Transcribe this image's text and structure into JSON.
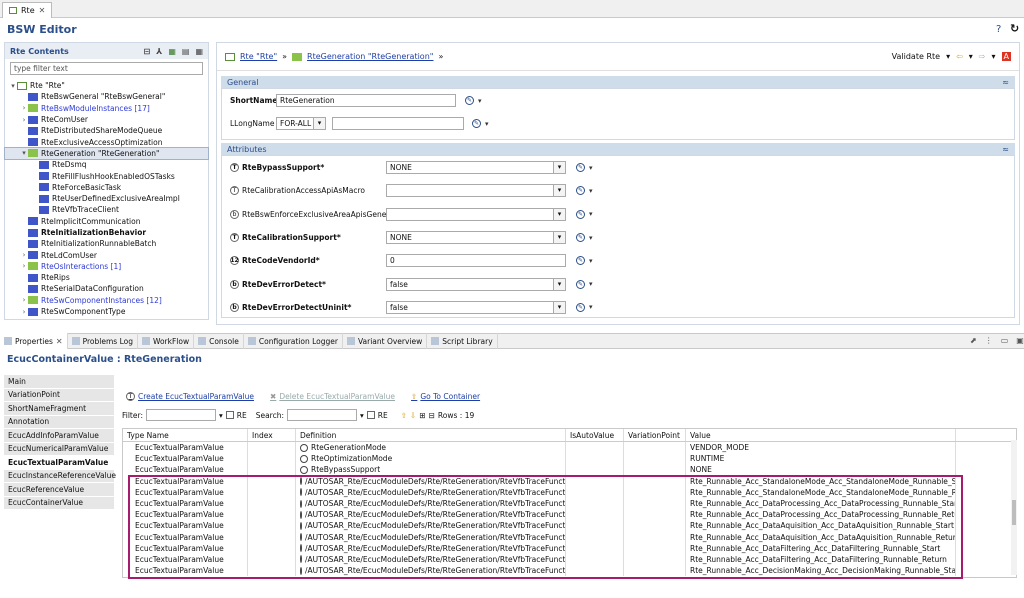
{
  "editor_tab": {
    "label": "Rte"
  },
  "editor_title": "BSW Editor",
  "left": {
    "header": "Rte Contents",
    "filter_placeholder": "type filter text",
    "tree": [
      {
        "label": "Rte \"Rte\"",
        "level": 0,
        "tw": "▾",
        "icon": "boxed"
      },
      {
        "label": "RteBswGeneral \"RteBswGeneral\"",
        "level": 1,
        "tw": "",
        "icon": "blue"
      },
      {
        "label": "RteBswModuleInstances [17]",
        "level": 1,
        "tw": "›",
        "icon": "green",
        "style": "blue-text"
      },
      {
        "label": "RteComUser",
        "level": 1,
        "tw": "›",
        "icon": "blue"
      },
      {
        "label": "RteDistributedShareModeQueue",
        "level": 1,
        "tw": "",
        "icon": "blue"
      },
      {
        "label": "RteExclusiveAccessOptimization",
        "level": 1,
        "tw": "",
        "icon": "blue"
      },
      {
        "label": "RteGeneration \"RteGeneration\"",
        "level": 1,
        "tw": "▾",
        "icon": "green",
        "selected": true
      },
      {
        "label": "RteDsmq",
        "level": 2,
        "tw": "",
        "icon": "blue"
      },
      {
        "label": "RteFillFlushHookEnabledOSTasks",
        "level": 2,
        "tw": "",
        "icon": "blue"
      },
      {
        "label": "RteForceBasicTask",
        "level": 2,
        "tw": "",
        "icon": "blue"
      },
      {
        "label": "RteUserDefinedExclusiveAreaImpl",
        "level": 2,
        "tw": "",
        "icon": "blue"
      },
      {
        "label": "RteVfbTraceClient",
        "level": 2,
        "tw": "",
        "icon": "blue"
      },
      {
        "label": "RteImplicitCommunication",
        "level": 1,
        "tw": "",
        "icon": "blue"
      },
      {
        "label": "RteInitializationBehavior",
        "level": 1,
        "tw": "",
        "icon": "blue",
        "style": "bold"
      },
      {
        "label": "RteInitializationRunnableBatch",
        "level": 1,
        "tw": "",
        "icon": "blue"
      },
      {
        "label": "RteLdComUser",
        "level": 1,
        "tw": "›",
        "icon": "blue"
      },
      {
        "label": "RteOsInteractions [1]",
        "level": 1,
        "tw": "›",
        "icon": "green",
        "style": "blue-text"
      },
      {
        "label": "RteRips",
        "level": 1,
        "tw": "",
        "icon": "blue"
      },
      {
        "label": "RteSerialDataConfiguration",
        "level": 1,
        "tw": "",
        "icon": "blue"
      },
      {
        "label": "RteSwComponentInstances [12]",
        "level": 1,
        "tw": "›",
        "icon": "green",
        "style": "blue-text"
      },
      {
        "label": "RteSwComponentType",
        "level": 1,
        "tw": "›",
        "icon": "blue"
      }
    ]
  },
  "breadcrumb": {
    "root": "Rte \"Rte\"",
    "sep": "»",
    "current": "RteGeneration \"RteGeneration\"",
    "end": "»",
    "validate": "Validate Rte"
  },
  "general": {
    "title": "General",
    "short_name_label": "ShortName*",
    "short_name_value": "RteGeneration",
    "long_name_label": "LLongName",
    "long_name_lang": "FOR-ALL",
    "long_name_value": ""
  },
  "attributes": {
    "title": "Attributes",
    "rows": [
      {
        "label": "RteBypassSupport*",
        "value": "NONE",
        "bold": true,
        "icon": "T"
      },
      {
        "label": "RteCalibrationAccessApiAsMacro",
        "value": "",
        "bold": false,
        "icon": "T"
      },
      {
        "label": "RteBswEnforceExclusiveAreaApisGeneration",
        "value": "",
        "bold": false,
        "icon": "b"
      },
      {
        "label": "RteCalibrationSupport*",
        "value": "NONE",
        "bold": true,
        "icon": "T"
      },
      {
        "label": "RteCodeVendorId*",
        "value": "0",
        "bold": true,
        "icon": "12"
      },
      {
        "label": "RteDevErrorDetect*",
        "value": "false",
        "bold": true,
        "icon": "b"
      },
      {
        "label": "RteDevErrorDetectUninit*",
        "value": "false",
        "bold": true,
        "icon": "b"
      }
    ]
  },
  "props_tabs": [
    "Properties",
    "Problems Log",
    "WorkFlow",
    "Console",
    "Configuration Logger",
    "Variant Overview",
    "Script Library"
  ],
  "props_title": "EcucContainerValue : RteGeneration",
  "side_items": [
    "Main",
    "VariationPoint",
    "ShortNameFragment",
    "Annotation",
    "EcucAddInfoParamValue",
    "EcucNumericalParamValue",
    "EcucTextualParamValue",
    "EcucInstanceReferenceValue",
    "EcucReferenceValue",
    "EcucContainerValue"
  ],
  "side_active": "EcucTextualParamValue",
  "actions": {
    "create": "Create EcucTextualParamValue",
    "delete": "Delete EcucTextualParamValue",
    "goto": "Go To Container"
  },
  "filter": {
    "filter_label": "Filter:",
    "re": "RE",
    "search_label": "Search:",
    "rows": "Rows : 19"
  },
  "grid": {
    "columns": [
      "Type Name",
      "Index",
      "Definition",
      "IsAutoValue",
      "VariationPoint",
      "Value"
    ],
    "rows": [
      [
        "EcucTextualParamValue",
        "",
        "RteGenerationMode",
        "",
        "",
        "VENDOR_MODE"
      ],
      [
        "EcucTextualParamValue",
        "",
        "RteOptimizationMode",
        "",
        "",
        "RUNTIME"
      ],
      [
        "EcucTextualParamValue",
        "",
        "RteBypassSupport",
        "",
        "",
        "NONE"
      ],
      [
        "EcucTextualParamValue",
        "",
        "/AUTOSAR_Rte/EcucModuleDefs/Rte/RteGeneration/RteVfbTraceFunction",
        "",
        "",
        "Rte_Runnable_Acc_StandaloneMode_Acc_StandaloneMode_Runnable_Start"
      ],
      [
        "EcucTextualParamValue",
        "",
        "/AUTOSAR_Rte/EcucModuleDefs/Rte/RteGeneration/RteVfbTraceFunction",
        "",
        "",
        "Rte_Runnable_Acc_StandaloneMode_Acc_StandaloneMode_Runnable_Return"
      ],
      [
        "EcucTextualParamValue",
        "",
        "/AUTOSAR_Rte/EcucModuleDefs/Rte/RteGeneration/RteVfbTraceFunction",
        "",
        "",
        "Rte_Runnable_Acc_DataProcessing_Acc_DataProcessing_Runnable_Start"
      ],
      [
        "EcucTextualParamValue",
        "",
        "/AUTOSAR_Rte/EcucModuleDefs/Rte/RteGeneration/RteVfbTraceFunction",
        "",
        "",
        "Rte_Runnable_Acc_DataProcessing_Acc_DataProcessing_Runnable_Return"
      ],
      [
        "EcucTextualParamValue",
        "",
        "/AUTOSAR_Rte/EcucModuleDefs/Rte/RteGeneration/RteVfbTraceFunction",
        "",
        "",
        "Rte_Runnable_Acc_DataAquisition_Acc_DataAquisition_Runnable_Start"
      ],
      [
        "EcucTextualParamValue",
        "",
        "/AUTOSAR_Rte/EcucModuleDefs/Rte/RteGeneration/RteVfbTraceFunction",
        "",
        "",
        "Rte_Runnable_Acc_DataAquisition_Acc_DataAquisition_Runnable_Return"
      ],
      [
        "EcucTextualParamValue",
        "",
        "/AUTOSAR_Rte/EcucModuleDefs/Rte/RteGeneration/RteVfbTraceFunction",
        "",
        "",
        "Rte_Runnable_Acc_DataFiltering_Acc_DataFiltering_Runnable_Start"
      ],
      [
        "EcucTextualParamValue",
        "",
        "/AUTOSAR_Rte/EcucModuleDefs/Rte/RteGeneration/RteVfbTraceFunction",
        "",
        "",
        "Rte_Runnable_Acc_DataFiltering_Acc_DataFiltering_Runnable_Return"
      ],
      [
        "EcucTextualParamValue",
        "",
        "/AUTOSAR_Rte/EcucModuleDefs/Rte/RteGeneration/RteVfbTraceFunction",
        "",
        "",
        "Rte_Runnable_Acc_DecisionMaking_Acc_DecisionMaking_Runnable_Start"
      ]
    ]
  },
  "colors": {
    "accent": "#2b4f8a",
    "highlight": "#a51b6d"
  }
}
